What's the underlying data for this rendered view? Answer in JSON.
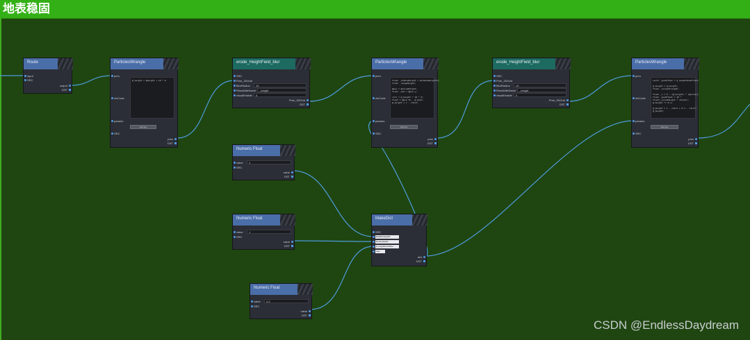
{
  "window": {
    "title": "地表稳固"
  },
  "colors": {
    "title_bar": "#34b017",
    "canvas": "#1f4610",
    "node_body": "#2b2e36",
    "header_blue": "#4a6ea8",
    "header_teal": "#1d6a60",
    "wire": "#4e9be0"
  },
  "nodes": {
    "route": {
      "title": "Route",
      "in_input": "input",
      "in_src": "SRC",
      "out_output": "output",
      "out_dst": "DST"
    },
    "pw1": {
      "title": "ParticlesWrangle",
      "in_prim": "prim",
      "in_zfx": "zfxCode",
      "in_params": "params",
      "in_src": "SRC",
      "code": "@_height = @height + 10 * 0",
      "add_btn": "Add key",
      "out_prim": "prim",
      "out_dst": "DST"
    },
    "erode1": {
      "title": "erode_HeightField_blur",
      "in_src": "SRC",
      "in_prim": "Prim_2DGrid",
      "params": [
        {
          "label": "BlurRadius",
          "value": "10"
        },
        {
          "label": "ResultAttrName",
          "value": "_height"
        },
        {
          "label": "visualEnable",
          "value": "0"
        }
      ],
      "out_prim": "Prim_2DGrid",
      "out_dst": "DST"
    },
    "pw2": {
      "title": "ParticlesWrangle",
      "in_prim": "prim",
      "in_zfx": "zfxCode",
      "in_params": "params",
      "in_src": "SRC",
      "code": "float _stableHeight = $stableHeightIn;\nfloat _rangeHeight;\n\n@pos = @noiseHeight;\nfloat _num = @pos.y;\n\ncoll = @_height * 10 * 0;\nfloat = @pos.th - @_heat;\n@_height = 1 - c4ist;",
      "add_btn": "Add key",
      "out_prim": "prim",
      "out_dst": "DST"
    },
    "erode2": {
      "title": "erode_HeightField_blur",
      "in_src": "SRC",
      "in_prim": "Prim_2DGrid",
      "params": [
        {
          "label": "BlurRadius",
          "value": "10"
        },
        {
          "label": "ResultAttrName",
          "value": "_height"
        },
        {
          "label": "visualEnable",
          "value": "0"
        }
      ],
      "out_prim": "Prim_2DGrid",
      "out_dst": "DST"
    },
    "pw3": {
      "title": "ParticlesWrangle",
      "in_prim": "prim",
      "in_zfx": "zfxCode",
      "in_params": "params",
      "in_src": "SRC",
      "code": "vec3f _posOffset = $_heightPosOffset;\n\n@_height = @_height;\nfloat _noiseStrength;\n\nfloat _x = 0 - (@_height) * (@noise);\nfloat _posOffset = 10 *\nfloat(_noiseHeight * c4iset);\n@_height *= 0.1;\n\n@_height = 1 - c4ist + 0.1 - c4ist;\n@_height;",
      "add_btn": "Add key",
      "out_prim": "prim",
      "out_dst": "DST"
    },
    "nf1": {
      "title": "Numeric Float",
      "in_value": "value",
      "in_src": "SRC",
      "value": "2",
      "out_value": "value",
      "out_dst": "DST"
    },
    "nf2": {
      "title": "Numeric Float",
      "in_value": "value",
      "in_src": "SRC",
      "value": "1",
      "out_value": "value",
      "out_dst": "DST"
    },
    "nf3": {
      "title": "Numeric Float",
      "in_value": "value",
      "in_src": "SRC",
      "value": "4.2",
      "out_value": "value",
      "out_dst": "DST"
    },
    "makedict": {
      "title": "MakeDict",
      "in_src": "SRC",
      "items": [
        "$stableHeightIn",
        "$noiseHeight",
        "$_heightPosOffset",
        "sigo"
      ],
      "out_dict": "dict",
      "out_dst": "DST"
    }
  },
  "watermark": "CSDN @EndlessDaydream"
}
